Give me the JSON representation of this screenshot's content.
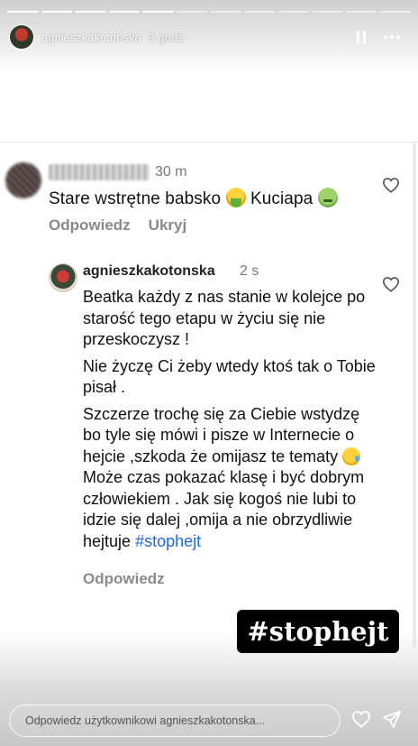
{
  "story": {
    "username": "agnieszkakotonska",
    "time": "3 godz.",
    "progress": {
      "segments": 12,
      "completed": 5
    }
  },
  "comment": {
    "username": "",
    "time": "30 m",
    "text_part1": "Stare wstrętne babsko",
    "text_part2": "Kuciapa",
    "reply_label": "Odpowiedz",
    "hide_label": "Ukryj"
  },
  "reply": {
    "username": "agnieszkakotonska",
    "time": "2 s",
    "paragraph1": "Beatka każdy z nas stanie w kolejce po starość tego etapu w życiu się nie przeskoczysz !",
    "paragraph2": "Nie życzę Ci żeby wtedy ktoś tak o Tobie pisał .",
    "paragraph3a": "Szczerze trochę się za Ciebie wstydzę bo tyle się mówi i pisze w Internecie o hejcie ,szkoda że omijasz te tematy",
    "paragraph3b": "Może czas pokazać klasę i być dobrym człowiekiem . Jak się kogoś nie lubi to idzie się dalej ,omija a nie obrzydliwie hejtuje",
    "hashtag": "#stophejt",
    "reply_label": "Odpowiedz"
  },
  "sticker": {
    "text": "#stophejt"
  },
  "footer": {
    "placeholder": "Odpowiedz użytkownikowi agnieszkakotonska..."
  },
  "icons": {
    "pause": "pause-icon",
    "more": "more-icon",
    "heart": "heart-icon",
    "send": "send-icon",
    "emoji1": "nauseated-face-emoji",
    "emoji2": "sick-face-emoji",
    "emoji3": "crying-face-emoji"
  },
  "colors": {
    "hashtag": "#1f6ad6",
    "sticker_bg": "#000000"
  }
}
